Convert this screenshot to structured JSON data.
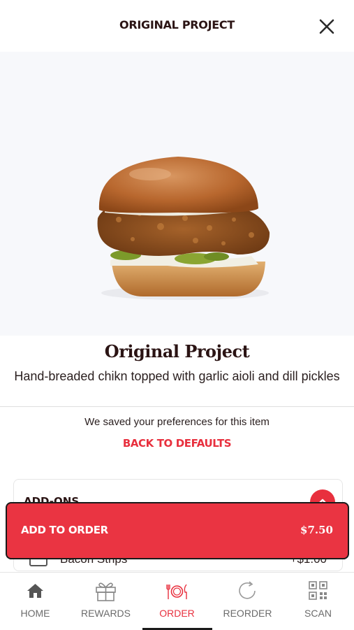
{
  "header": {
    "title": "ORIGINAL PROJECT"
  },
  "item": {
    "name": "Original Project",
    "description": "Hand-breaded chikn topped with garlic aioli and dill pickles",
    "preferences_note": "We saved your preferences for this item",
    "back_to_defaults": "BACK TO DEFAULTS"
  },
  "addons": {
    "title": "ADD-ONS",
    "items": [
      {
        "name": "Bacon Strips",
        "price": "+$1.00"
      }
    ]
  },
  "order_bar": {
    "label": "ADD TO ORDER",
    "price": "$7.50"
  },
  "tabbar": {
    "tabs": [
      {
        "label": "HOME",
        "icon": "home-icon"
      },
      {
        "label": "REWARDS",
        "icon": "gift-icon"
      },
      {
        "label": "ORDER",
        "icon": "plate-fork-knife-icon",
        "active": true
      },
      {
        "label": "REORDER",
        "icon": "refresh-icon"
      },
      {
        "label": "SCAN",
        "icon": "qr-code-icon"
      }
    ]
  },
  "colors": {
    "accent": "#e8303e",
    "text": "#2b1414",
    "muted": "#6b6b6b"
  }
}
